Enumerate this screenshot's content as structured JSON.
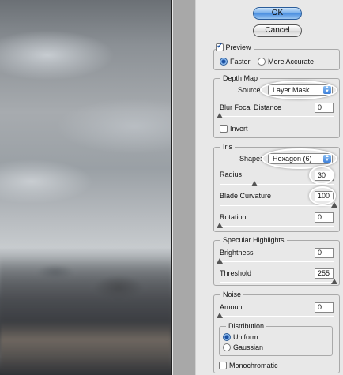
{
  "buttons": {
    "ok": "OK",
    "cancel": "Cancel"
  },
  "preview": {
    "label": "Preview",
    "checked": true,
    "options": [
      "Faster",
      "More Accurate"
    ],
    "selected": "Faster"
  },
  "depth_map": {
    "title": "Depth Map",
    "source_label": "Source:",
    "source_value": "Layer Mask",
    "blur_focal_label": "Blur Focal Distance",
    "blur_focal_value": "0",
    "blur_focal_level": 0,
    "invert_label": "Invert",
    "invert_checked": false
  },
  "iris": {
    "title": "Iris",
    "shape_label": "Shape:",
    "shape_value": "Hexagon (6)",
    "radius_label": "Radius",
    "radius_value": "30",
    "radius_level": 0.3,
    "blade_label": "Blade Curvature",
    "blade_value": "100",
    "blade_level": 1.0,
    "rotation_label": "Rotation",
    "rotation_value": "0",
    "rotation_level": 0
  },
  "specular": {
    "title": "Specular Highlights",
    "brightness_label": "Brightness",
    "brightness_value": "0",
    "brightness_level": 0,
    "threshold_label": "Threshold",
    "threshold_value": "255",
    "threshold_level": 1.0
  },
  "noise": {
    "title": "Noise",
    "amount_label": "Amount",
    "amount_value": "0",
    "amount_level": 0,
    "distribution_title": "Distribution",
    "distribution_options": [
      "Uniform",
      "Gaussian"
    ],
    "distribution_selected": "Uniform",
    "monochromatic_label": "Monochromatic",
    "monochromatic_checked": false
  }
}
